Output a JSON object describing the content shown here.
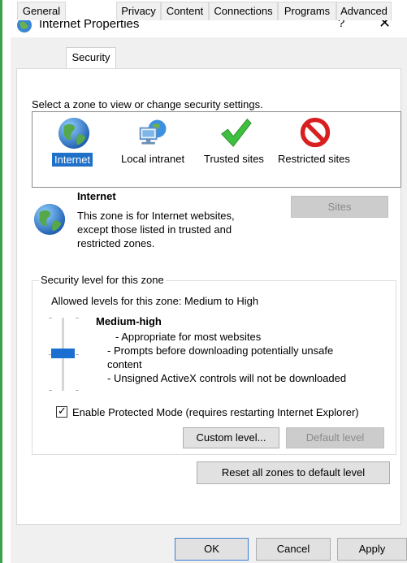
{
  "window": {
    "title": "Internet Properties",
    "help": "?",
    "close": "✕"
  },
  "tabs": [
    "General",
    "Security",
    "Privacy",
    "Content",
    "Connections",
    "Programs",
    "Advanced"
  ],
  "active_tab": "Security",
  "zone_prompt": "Select a zone to view or change security settings.",
  "zones": [
    {
      "label": "Internet",
      "icon": "globe-icon",
      "selected": true
    },
    {
      "label": "Local intranet",
      "icon": "network-computer-icon",
      "selected": false
    },
    {
      "label": "Trusted sites",
      "icon": "green-check-icon",
      "selected": false
    },
    {
      "label": "Restricted sites",
      "icon": "no-entry-icon",
      "selected": false
    }
  ],
  "zone_info": {
    "name": "Internet",
    "description": "This zone is for Internet websites, except those listed in trusted and restricted zones."
  },
  "buttons": {
    "sites": "Sites",
    "custom_level": "Custom level...",
    "default_level": "Default level",
    "reset_all": "Reset all zones to default level",
    "ok": "OK",
    "cancel": "Cancel",
    "apply": "Apply"
  },
  "security_level": {
    "group_label": "Security level for this zone",
    "allowed": "Allowed levels for this zone: Medium to High",
    "level_name": "Medium-high",
    "bullets": [
      "- Appropriate for most websites",
      "- Prompts before downloading potentially unsafe",
      "content",
      "- Unsigned ActiveX controls will not be downloaded"
    ]
  },
  "protected_mode": {
    "label": "Enable Protected Mode (requires restarting Internet Explorer)",
    "checked": true
  },
  "colors": {
    "selection": "#1f70c8",
    "slider_thumb": "#1a6fd0",
    "frame_accent": "#3aa34a"
  }
}
